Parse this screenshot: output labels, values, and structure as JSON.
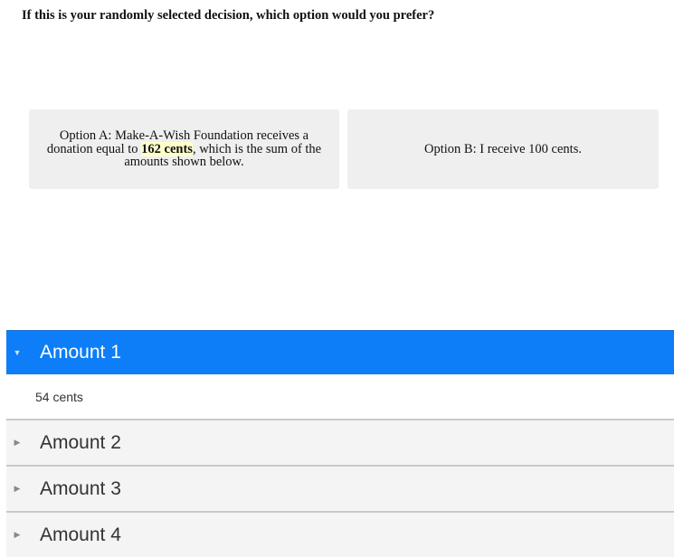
{
  "question": "If this is your randomly selected decision, which option would you prefer?",
  "option_a": {
    "prefix": "Option A:  Make-A-Wish Foundation receives a donation equal to ",
    "amount": "162 cents",
    "suffix": ", which is the sum of the amounts shown below."
  },
  "option_b": {
    "label": "Option B: I receive 100 cents."
  },
  "accordion": {
    "items": [
      {
        "title": "Amount 1",
        "content": "54 cents",
        "expanded": true
      },
      {
        "title": "Amount 2",
        "expanded": false
      },
      {
        "title": "Amount 3",
        "expanded": false
      },
      {
        "title": "Amount 4",
        "expanded": false
      }
    ]
  },
  "colors": {
    "accent": "#0d7ef7",
    "option_bg": "#efefef",
    "highlight": "#ffffcc"
  },
  "icons": {
    "expanded": "caret-down-icon",
    "collapsed": "caret-right-icon"
  }
}
